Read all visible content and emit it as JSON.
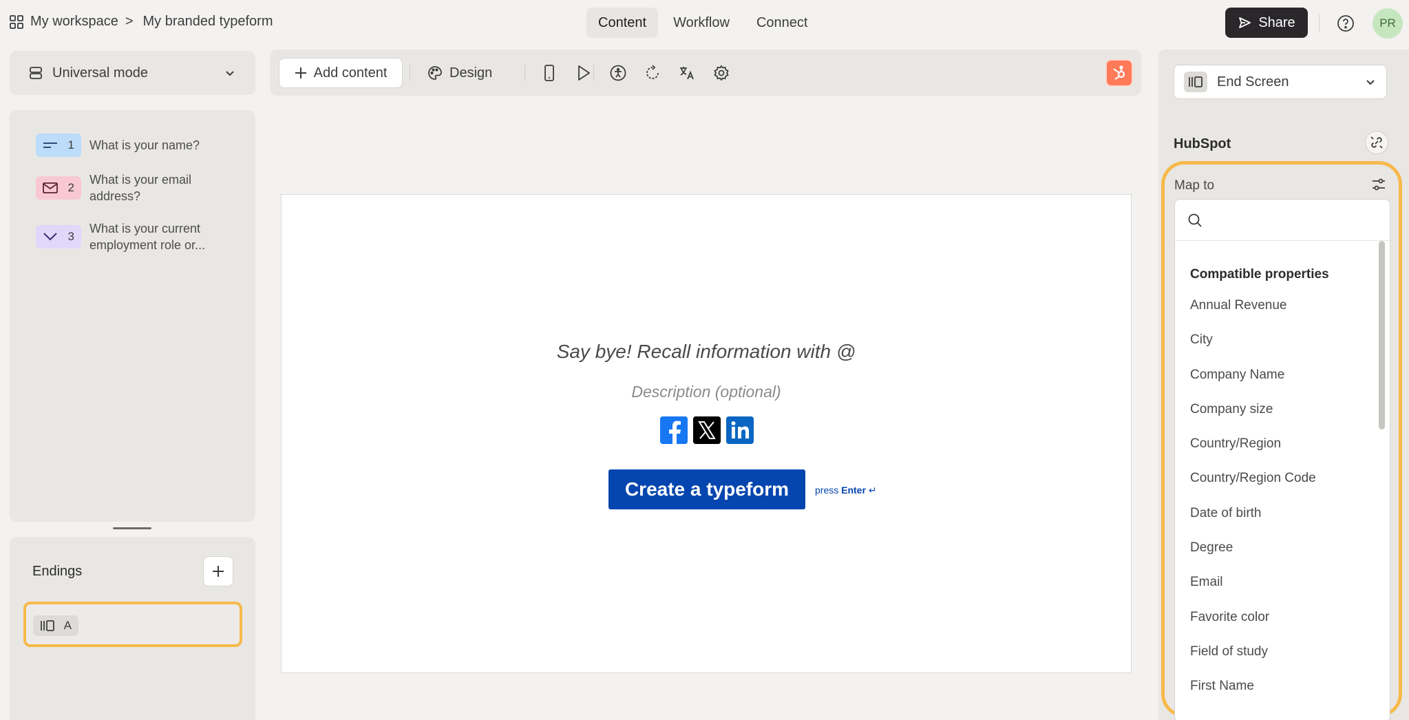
{
  "breadcrumb": {
    "workspace": "My workspace",
    "separator": ">",
    "form_name": "My branded typeform"
  },
  "tabs": [
    {
      "label": "Content",
      "active": true
    },
    {
      "label": "Workflow",
      "active": false
    },
    {
      "label": "Connect",
      "active": false
    }
  ],
  "share_label": "Share",
  "avatar_initials": "PR",
  "mode": {
    "label": "Universal mode"
  },
  "questions": [
    {
      "number": "1",
      "icon": "short-text-icon",
      "text": "What is your name?",
      "color": "#bcdcf9"
    },
    {
      "number": "2",
      "icon": "email-icon",
      "text": "What is your email address?",
      "color": "#f8c9d3"
    },
    {
      "number": "3",
      "icon": "dropdown-icon",
      "text": "What is your current employment role or...",
      "color": "#e1d7fb"
    }
  ],
  "endings": {
    "title": "Endings",
    "items": [
      {
        "letter": "A",
        "icon": "end-screen-icon"
      }
    ]
  },
  "toolbar": {
    "add_content": "Add content",
    "design": "Design"
  },
  "canvas": {
    "title": "Say bye! Recall information with @",
    "description": "Description (optional)",
    "cta_label": "Create a typeform",
    "press_hint": "press",
    "press_key": "Enter",
    "press_symbol": "↵",
    "socials": [
      "facebook-icon",
      "x-icon",
      "linkedin-icon"
    ]
  },
  "right_panel": {
    "screen_select": "End Screen",
    "integration": "HubSpot",
    "map_to": "Map to",
    "search_value": "",
    "group_title": "Compatible properties",
    "properties": [
      "Annual Revenue",
      "City",
      "Company Name",
      "Company size",
      "Country/Region",
      "Country/Region Code",
      "Date of birth",
      "Degree",
      "Email",
      "Favorite color",
      "Field of study",
      "First Name"
    ]
  },
  "colors": {
    "accent": "#0445af",
    "highlight": "#f7b94a",
    "hubspot": "#ff7a59",
    "share_bg": "#2a272b"
  }
}
